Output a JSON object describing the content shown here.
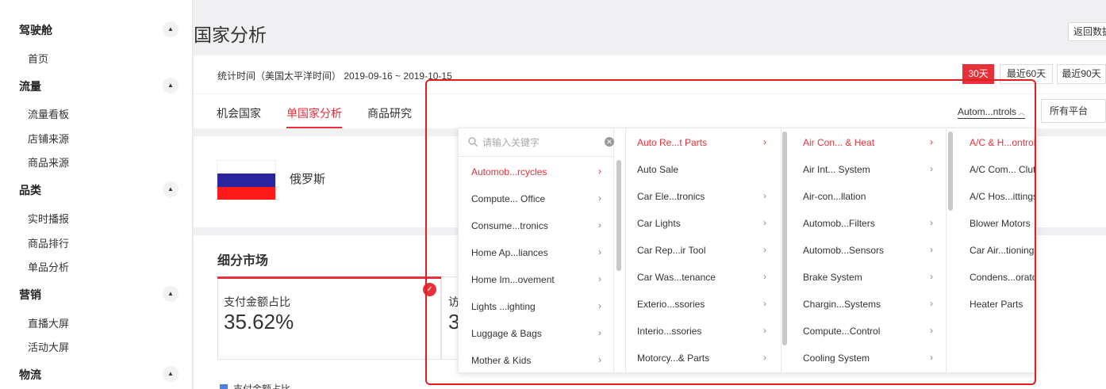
{
  "sidebar": {
    "sections": [
      {
        "title": "驾驶舱",
        "items": [
          "首页"
        ]
      },
      {
        "title": "流量",
        "items": [
          "流量看板",
          "店铺来源",
          "商品来源"
        ]
      },
      {
        "title": "品类",
        "items": [
          "实时播报",
          "商品排行",
          "单品分析"
        ]
      },
      {
        "title": "营销",
        "items": [
          "直播大屏",
          "活动大屏"
        ]
      },
      {
        "title": "物流",
        "items": []
      }
    ],
    "toggle_glyph": "▲"
  },
  "header": {
    "title": "国家分析",
    "back_button": "返回数据"
  },
  "toolbar": {
    "stat_time": "统计时间（美国太平洋时间） 2019-09-16 ~ 2019-10-15",
    "ranges": [
      "30天",
      "最近60天",
      "最近90天"
    ],
    "active_range": 0
  },
  "tabs": {
    "items": [
      "机会国家",
      "单国家分析",
      "商品研究"
    ],
    "active": 1
  },
  "filters": {
    "category": "Autom...ntrols",
    "platform": "所有平台"
  },
  "country": {
    "name": "俄罗斯"
  },
  "segment": {
    "title": "细分市场",
    "card1": {
      "label": "支付金额占比",
      "value": "35.62%"
    },
    "card2": {
      "label": "访",
      "value": "3"
    },
    "legend": "支付金额占比"
  },
  "dropdown": {
    "search_placeholder": "请输入关键字",
    "columns": [
      {
        "items": [
          "Automob...rcycles",
          "Compute... Office",
          "Consume...tronics",
          "Home Ap...liances",
          "Home Im...ovement",
          "Lights ...ighting",
          "Luggage & Bags",
          "Mother & Kids"
        ],
        "active": 0,
        "chevrons": [
          true,
          true,
          true,
          true,
          true,
          true,
          true,
          true
        ]
      },
      {
        "items": [
          "Auto Re...t Parts",
          "Auto Sale",
          "Car Ele...tronics",
          "Car Lights",
          "Car Rep...ir Tool",
          "Car Was...tenance",
          "Exterio...ssories",
          "Interio...ssories",
          "Motorcy...& Parts"
        ],
        "active": 0,
        "chevrons": [
          true,
          false,
          true,
          true,
          true,
          true,
          true,
          true,
          true
        ]
      },
      {
        "items": [
          "Air Con... & Heat",
          "Air Int... System",
          "Air-con...llation",
          "Automob...Filters",
          "Automob...Sensors",
          "Brake System",
          "Chargin...Systems",
          "Compute...Control",
          "Cooling System"
        ],
        "active": 0,
        "chevrons": [
          true,
          true,
          false,
          true,
          true,
          true,
          true,
          true,
          true
        ]
      },
      {
        "items": [
          "A/C & H...ontrols",
          "A/C Com... Clutch",
          "A/C Hos...ittings",
          "Blower Motors",
          "Car Air...tioning",
          "Condens...orators",
          "Heater Parts"
        ],
        "active": 0,
        "chevrons": [
          false,
          false,
          false,
          false,
          false,
          false,
          false
        ]
      }
    ],
    "chevron_glyph": "›"
  },
  "colors": {
    "accent": "#e8303a",
    "highlight_box": "#e02020"
  }
}
